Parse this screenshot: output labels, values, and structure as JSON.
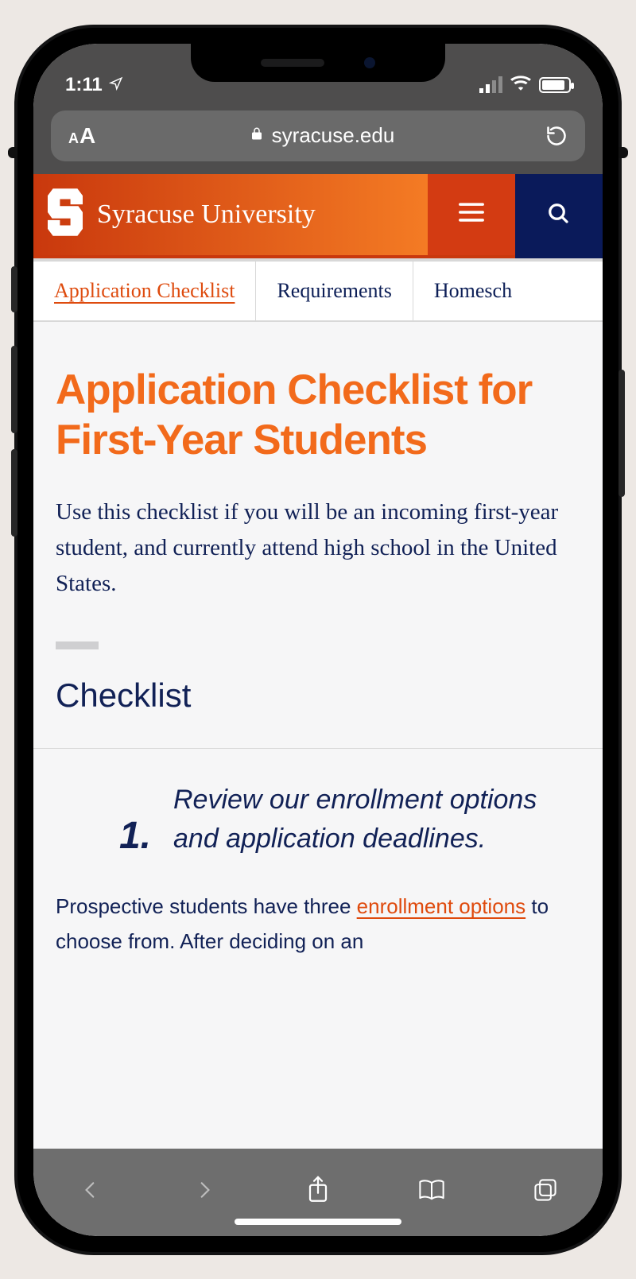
{
  "statusbar": {
    "time": "1:11",
    "location_services": true
  },
  "browser": {
    "text_size_label": "AA",
    "domain": "syracuse.edu",
    "secure": true
  },
  "site_header": {
    "brand_name": "Syracuse University",
    "logo_letter": "S"
  },
  "tabs": [
    {
      "label": "Application Checklist",
      "active": true
    },
    {
      "label": "Requirements",
      "active": false
    },
    {
      "label": "Homesch",
      "active": false
    }
  ],
  "page": {
    "title": "Application Checklist for First-Year Students",
    "lead": "Use this checklist if you will be an incoming first-year student, and currently attend high school in the United States.",
    "section_heading": "Checklist",
    "step": {
      "number": "1.",
      "text": "Review our enrollment options and application deadlines."
    },
    "body_pre": "Prospective students have three ",
    "body_link": "enrollment options",
    "body_post": " to choose from. After deciding on an"
  },
  "colors": {
    "brand_orange": "#f26a1b",
    "brand_navy": "#0d1f57",
    "brand_red": "#c9380d"
  }
}
